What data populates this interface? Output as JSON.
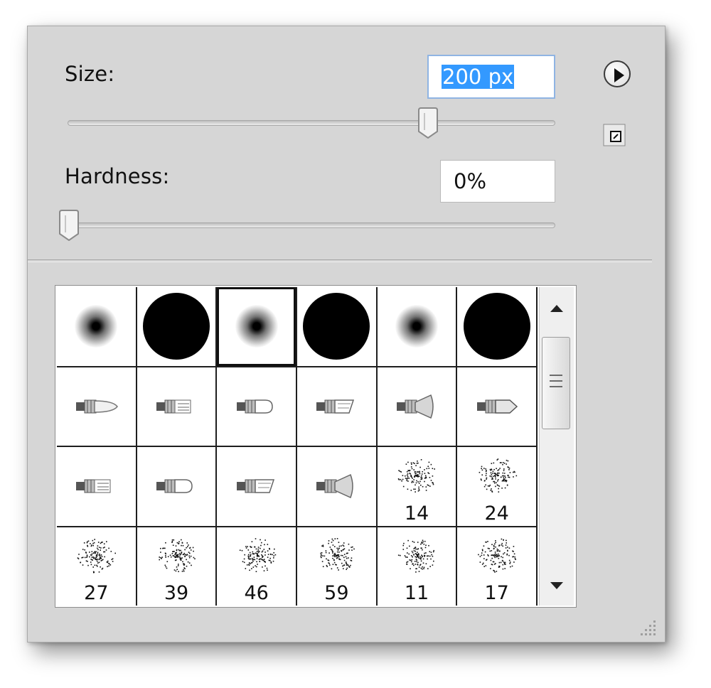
{
  "brush_panel": {
    "size": {
      "label": "Size:",
      "value": "200 px",
      "slider_fraction": 0.75
    },
    "hardness": {
      "label": "Hardness:",
      "value": "0%",
      "slider_fraction": 0.0
    },
    "menu_icon": "play-arrow-circle-icon",
    "new_preset_icon": "new-preset-icon",
    "accent_color": "#3399ff"
  },
  "presets": [
    {
      "kind": "soft",
      "label": ""
    },
    {
      "kind": "hard",
      "label": ""
    },
    {
      "kind": "soft",
      "label": "",
      "selected": true
    },
    {
      "kind": "hard",
      "label": ""
    },
    {
      "kind": "soft",
      "label": ""
    },
    {
      "kind": "hard",
      "label": ""
    },
    {
      "kind": "bristle-a",
      "label": ""
    },
    {
      "kind": "bristle-b",
      "label": ""
    },
    {
      "kind": "bristle-c",
      "label": ""
    },
    {
      "kind": "bristle-d",
      "label": ""
    },
    {
      "kind": "bristle-e",
      "label": ""
    },
    {
      "kind": "bristle-f",
      "label": ""
    },
    {
      "kind": "bristle-b",
      "label": ""
    },
    {
      "kind": "bristle-c",
      "label": ""
    },
    {
      "kind": "bristle-d",
      "label": ""
    },
    {
      "kind": "bristle-e",
      "label": ""
    },
    {
      "kind": "scatter",
      "label": "14"
    },
    {
      "kind": "scatter",
      "label": "24"
    },
    {
      "kind": "scatter",
      "label": "27"
    },
    {
      "kind": "scatter",
      "label": "39"
    },
    {
      "kind": "scatter",
      "label": "46"
    },
    {
      "kind": "scatter",
      "label": "59"
    },
    {
      "kind": "scatter",
      "label": "11"
    },
    {
      "kind": "scatter",
      "label": "17"
    }
  ]
}
